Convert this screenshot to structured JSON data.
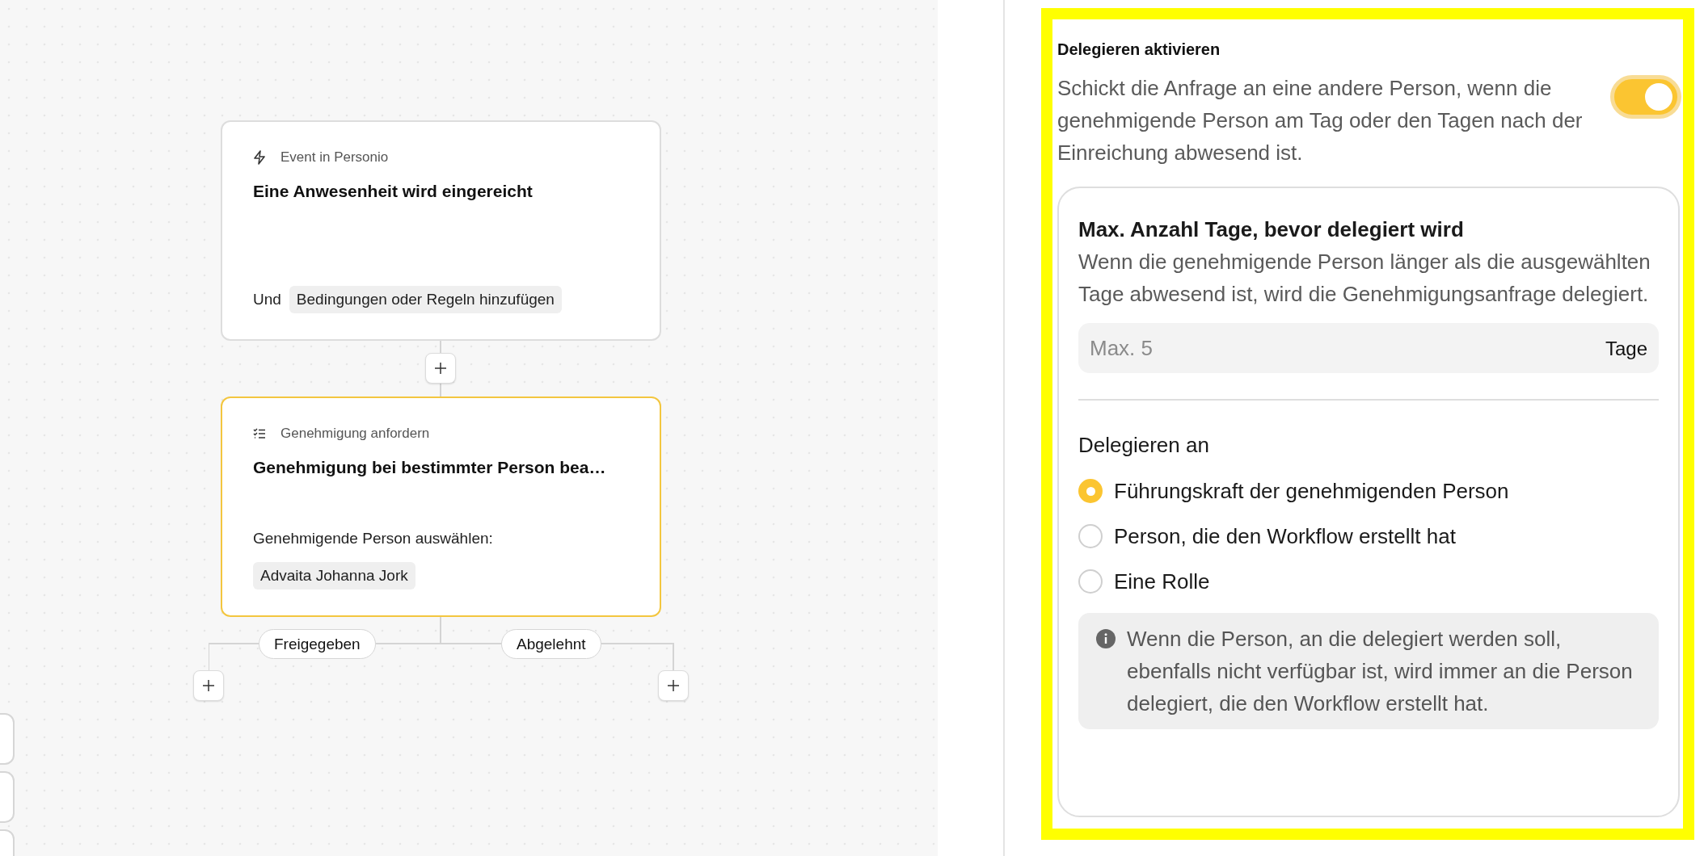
{
  "canvas": {
    "nodes": [
      {
        "kind": "trigger",
        "caption": "Event in Personio",
        "title": "Eine Anwesenheit wird eingereicht",
        "selected": false,
        "conjunction": "Und",
        "chip": "Bedingungen oder Regeln hinzufügen"
      },
      {
        "kind": "approval",
        "caption": "Genehmigung anfordern",
        "title": "Genehmigung bei bestimmter Person bea…",
        "selected": true,
        "label": "Genehmigende Person auswählen:",
        "chip": "Advaita Johanna Jork"
      }
    ],
    "branches": [
      "Freigegeben",
      "Abgelehnt"
    ]
  },
  "panel": {
    "title": "Delegieren aktivieren",
    "description": "Schickt die Anfrage an eine andere Person, wenn die genehmigende Person am Tag oder den Tagen nach der Einreichung abwesend ist.",
    "toggle_on": true,
    "settings": {
      "heading": "Max. Anzahl Tage, bevor delegiert wird",
      "description": "Wenn die genehmigende Person länger als die ausgewählten Tage abwesend ist, wird die Genehmigungsanfrage delegiert.",
      "input": {
        "placeholder": "Max. 5",
        "unit": "Tage"
      },
      "delegate_heading": "Delegieren an",
      "options": [
        {
          "label": "Führungskraft der genehmigenden Person",
          "selected": true
        },
        {
          "label": "Person, die den Workflow erstellt hat",
          "selected": false
        },
        {
          "label": "Eine Rolle",
          "selected": false
        }
      ],
      "info": "Wenn die Person, an die delegiert werden soll, ebenfalls nicht verfügbar ist, wird immer an die Person delegiert, die den Workflow erstellt hat."
    }
  }
}
